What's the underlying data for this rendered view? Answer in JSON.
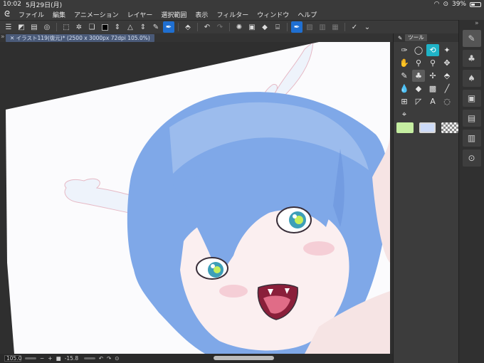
{
  "status": {
    "time": "10:02",
    "date": "5月29日(月)",
    "battery": "39%",
    "battery_level": 0.39
  },
  "menu": {
    "items": [
      "ファイル",
      "編集",
      "アニメーション",
      "レイヤー",
      "選択範囲",
      "表示",
      "フィルター",
      "ウィンドウ",
      "ヘルプ"
    ]
  },
  "document": {
    "tab_label": "イラスト119(復元)* (2500 x 3000px 72dpi 105.0%)"
  },
  "panel": {
    "title": "ツール"
  },
  "bottom": {
    "zoom": "105.0",
    "angle": "-15.8"
  },
  "colors": {
    "main": "#c5eea1",
    "sub": "#cddbf8",
    "accent": "#1f6fd1",
    "selected_tool": "#1fb3c7"
  }
}
